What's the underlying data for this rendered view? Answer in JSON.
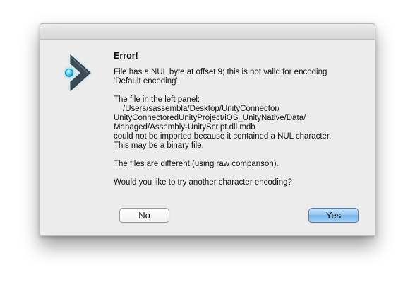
{
  "dialog": {
    "icon": "app-chevron-icon",
    "title": "Error!",
    "message": {
      "p1": [
        "File has a NUL byte at offset 9; this is not valid for encoding",
        "'Default encoding'."
      ],
      "p2": [
        "The file in the left panel:",
        "/Users/sassembla/Desktop/UnityConnector/",
        "UnityConnectoredUnityProject/iOS_UnityNative/Data/",
        "Managed/Assembly-UnityScript.dll.mdb",
        "could not be imported because it contained a NUL character.",
        "This may be a binary file."
      ],
      "p3": "The files are different (using raw comparison).",
      "p4": "Would you like to try another character encoding?"
    },
    "buttons": {
      "no": "No",
      "yes": "Yes"
    },
    "colors": {
      "default_button": "#74b2ea",
      "icon_chevron": "#3d4b55",
      "icon_glow": "#4fd3f5"
    }
  }
}
